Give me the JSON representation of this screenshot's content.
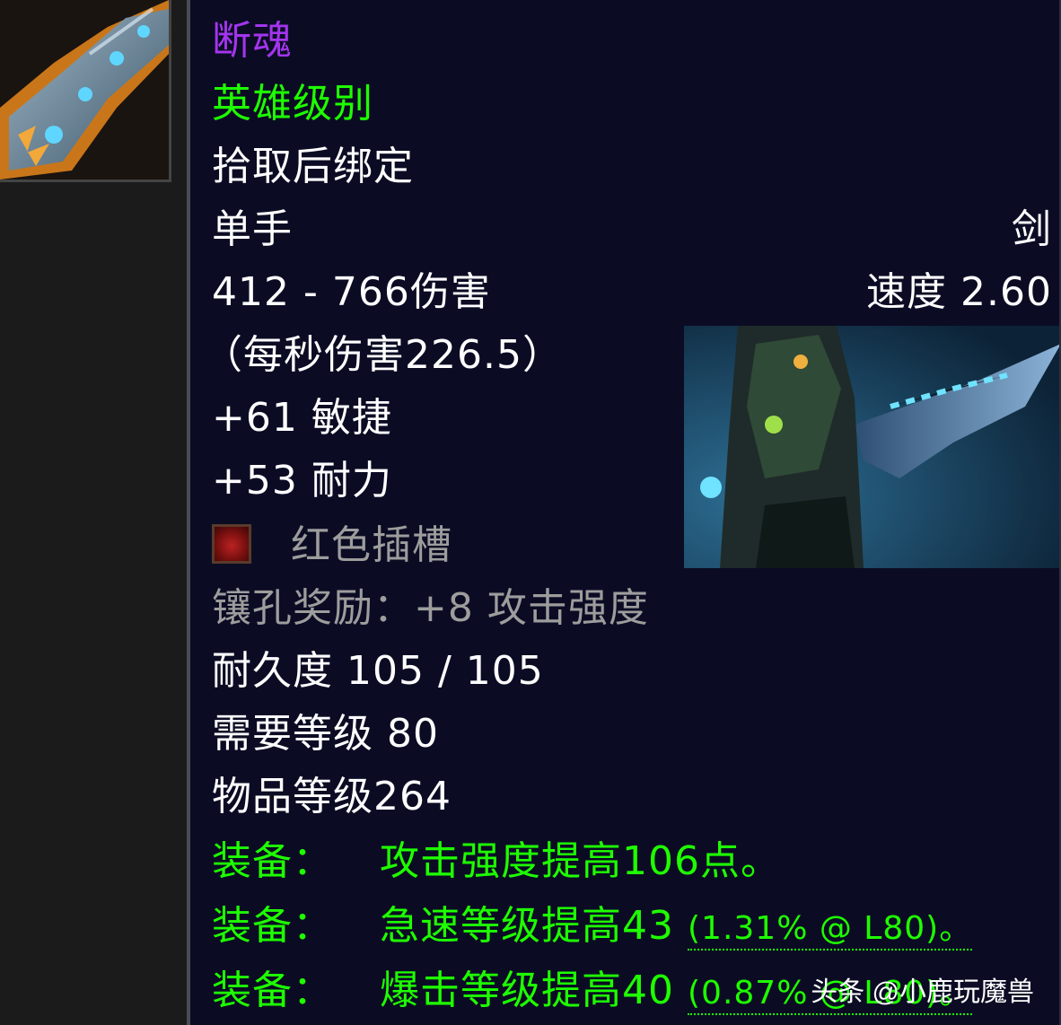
{
  "item": {
    "name": "断魂",
    "quality": "英雄级别",
    "binding": "拾取后绑定",
    "slot": "单手",
    "weapon_type": "剑",
    "damage": "412 - 766伤害",
    "speed": "速度 2.60",
    "dps": "（每秒伤害226.5）",
    "stat_agility": "+61 敏捷",
    "stat_stamina": "+53 耐力",
    "socket": "红色插槽",
    "socket_bonus": "镶孔奖励：+8 攻击强度",
    "durability": "耐久度 105 / 105",
    "required_level": "需要等级 80",
    "item_level": "物品等级264",
    "equip_label": "装备：",
    "equip_1": "攻击强度提高106点。",
    "equip_2": "急速等级提高43",
    "equip_2_detail": "(1.31% @ L80)。",
    "equip_3": "爆击等级提高40",
    "equip_3_detail": "(0.87% @ L80)。"
  },
  "icons": {
    "item_icon": "sword-icon",
    "socket_icon": "red-socket-icon"
  },
  "watermark": "头条 @小鹿玩魔兽",
  "colors": {
    "epic": "#a335ee",
    "uncommon": "#1eff00",
    "gray": "#9d9d9d",
    "tooltip_bg": "#0b0c24"
  }
}
